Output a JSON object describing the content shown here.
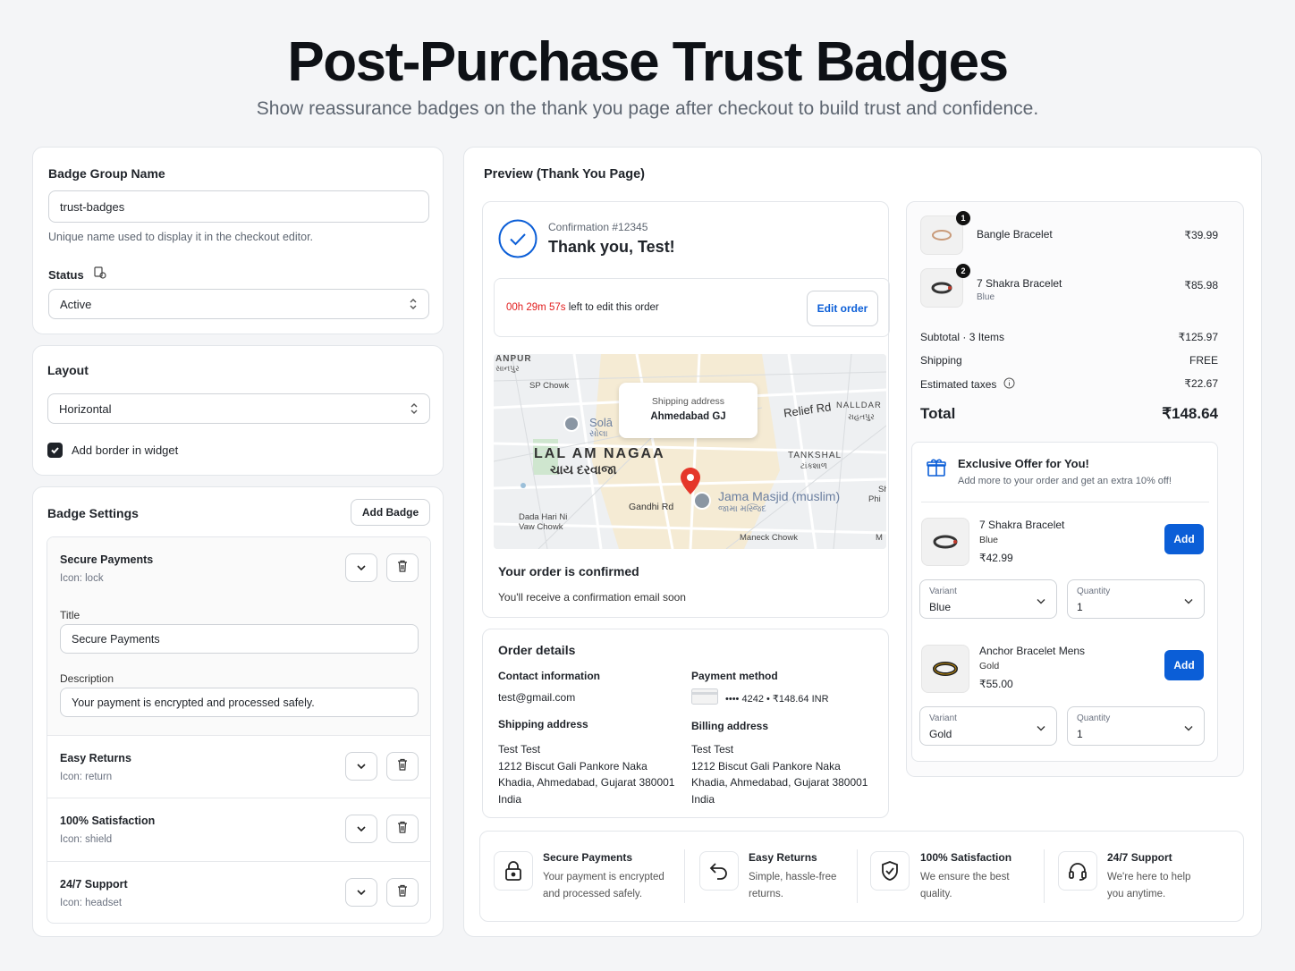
{
  "hero": {
    "title": "Post-Purchase Trust Badges",
    "subtitle": "Show reassurance badges on the thank you page after checkout to build trust and confidence."
  },
  "settings": {
    "group_name_label": "Badge Group Name",
    "group_name_value": "trust-badges",
    "group_name_help": "Unique name used to display it in the checkout editor.",
    "status_label": "Status",
    "status_value": "Active",
    "layout_label": "Layout",
    "layout_value": "Horizontal",
    "border_checkbox_label": "Add border in widget",
    "border_checked": true
  },
  "badge_settings": {
    "heading": "Badge Settings",
    "add_button": "Add Badge",
    "title_label": "Title",
    "description_label": "Description",
    "badges": [
      {
        "name": "Secure Payments",
        "icon": "Icon: lock",
        "title": "Secure Payments",
        "description": "Your payment is encrypted and processed safely."
      },
      {
        "name": "Easy Returns",
        "icon": "Icon: return"
      },
      {
        "name": "100% Satisfaction",
        "icon": "Icon: shield"
      },
      {
        "name": "24/7 Support",
        "icon": "Icon: headset"
      }
    ]
  },
  "preview": {
    "heading": "Preview (Thank You Page)",
    "confirmation_number": "Confirmation #12345",
    "thank_you": "Thank you, Test!",
    "timer": "00h 29m 57s",
    "timer_suffix": "left to edit this order",
    "edit_button": "Edit order",
    "map": {
      "tooltip_label": "Shipping address",
      "tooltip_value": "Ahmedabad GJ",
      "labels": [
        "ANPUR",
        "સાનપુર",
        "SP Chowk",
        "Solā",
        "સોલા",
        "LAL AM NAGAA",
        "ચાય દરવાજા",
        "Relief Rd",
        "NALLDAR",
        "રાહતપુર",
        "TANKSHAL",
        "ટાંકશાળ",
        "Jama Masjid (muslim)",
        "જામા મસ્જિદ",
        "Gandhi Rd",
        "Dada Hari Ni Vaw Chowk",
        "Maneck Chowk",
        "Sh",
        "Phi",
        "M"
      ]
    },
    "confirmed_title": "Your order is confirmed",
    "confirmed_sub": "You'll receive a confirmation email soon",
    "order_details": {
      "heading": "Order details",
      "contact_label": "Contact information",
      "contact_value": "test@gmail.com",
      "payment_label": "Payment method",
      "payment_value": "•••• 4242 • ₹148.64 INR",
      "shipping_label": "Shipping address",
      "shipping_lines": [
        "Test Test",
        "1212 Biscut Gali Pankore Naka",
        "Khadia, Ahmedabad, Gujarat 380001",
        "India"
      ],
      "billing_label": "Billing address",
      "billing_lines": [
        "Test Test",
        "1212 Biscut Gali Pankore Naka",
        "Khadia, Ahmedabad, Gujarat 380001",
        "India"
      ]
    },
    "summary": {
      "items": [
        {
          "qty": "1",
          "name": "Bangle Bracelet",
          "variant": "",
          "price": "₹39.99"
        },
        {
          "qty": "2",
          "name": "7 Shakra Bracelet",
          "variant": "Blue",
          "price": "₹85.98"
        }
      ],
      "subtotal_label": "Subtotal · 3 Items",
      "subtotal_value": "₹125.97",
      "shipping_label": "Shipping",
      "shipping_value": "FREE",
      "taxes_label": "Estimated taxes",
      "taxes_value": "₹22.67",
      "total_label": "Total",
      "total_value": "₹148.64"
    },
    "offer": {
      "title": "Exclusive Offer for You!",
      "subtitle": "Add more to your order and get an extra 10% off!",
      "variant_label": "Variant",
      "quantity_label": "Quantity",
      "add_label": "Add",
      "products": [
        {
          "name": "7 Shakra Bracelet",
          "variant": "Blue",
          "price": "₹42.99",
          "variant_value": "Blue",
          "quantity_value": "1"
        },
        {
          "name": "Anchor Bracelet Mens",
          "variant": "Gold",
          "price": "₹55.00",
          "variant_value": "Gold",
          "quantity_value": "1"
        }
      ]
    },
    "trust_badges": [
      {
        "title": "Secure Payments",
        "desc1": "Your payment is encrypted",
        "desc2": "and processed safely.",
        "icon": "lock-icon"
      },
      {
        "title": "Easy Returns",
        "desc1": "Simple, hassle-free",
        "desc2": "returns.",
        "icon": "return-icon"
      },
      {
        "title": "100% Satisfaction",
        "desc1": "We ensure the best",
        "desc2": "quality.",
        "icon": "shield-icon"
      },
      {
        "title": "24/7 Support",
        "desc1": "We're here to help",
        "desc2": "you anytime.",
        "icon": "headset-icon"
      }
    ]
  },
  "colors": {
    "accent": "#0b5ed7",
    "timer": "#e11d1d",
    "checkbox": "#1f2329"
  }
}
